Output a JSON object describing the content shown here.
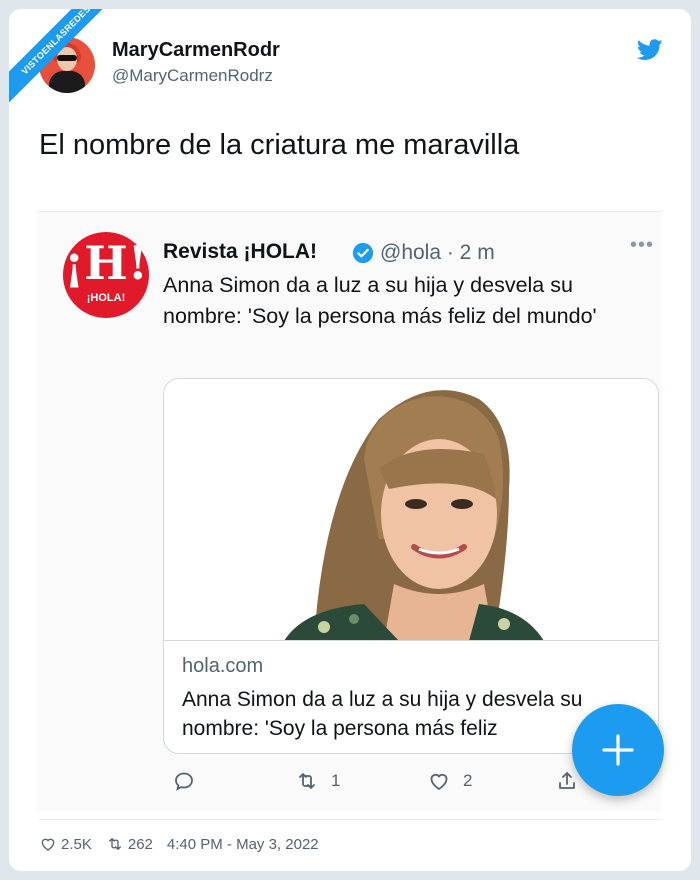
{
  "watermark": "VISTOENLASREDES",
  "author": {
    "name": "MaryCarmenRodr",
    "handle": "@MaryCarmenRodrz"
  },
  "tweet": {
    "text": "El nombre de la criatura me maravilla"
  },
  "quoted": {
    "logo_big": "¡H!",
    "logo_small": "¡HOLA!",
    "name": "Revista ¡HOLA!",
    "handle_time": "@hola · 2 m",
    "more": "•••",
    "text": "Anna Simon da a luz a su hija y desvela su nombre: 'Soy la persona más feliz del mundo'",
    "link": {
      "domain": "hola.com",
      "title": "Anna Simon da a luz a su hija y desvela su nombre: 'Soy la persona más feliz"
    },
    "actions": {
      "retweets": "1",
      "likes": "2"
    }
  },
  "footer": {
    "likes": "2.5K",
    "retweets": "262",
    "timestamp": "4:40 PM - May 3, 2022"
  },
  "colors": {
    "accent": "#1d9bf0",
    "hola_red": "#e0192b",
    "avatar_bg": "#e6503d"
  }
}
